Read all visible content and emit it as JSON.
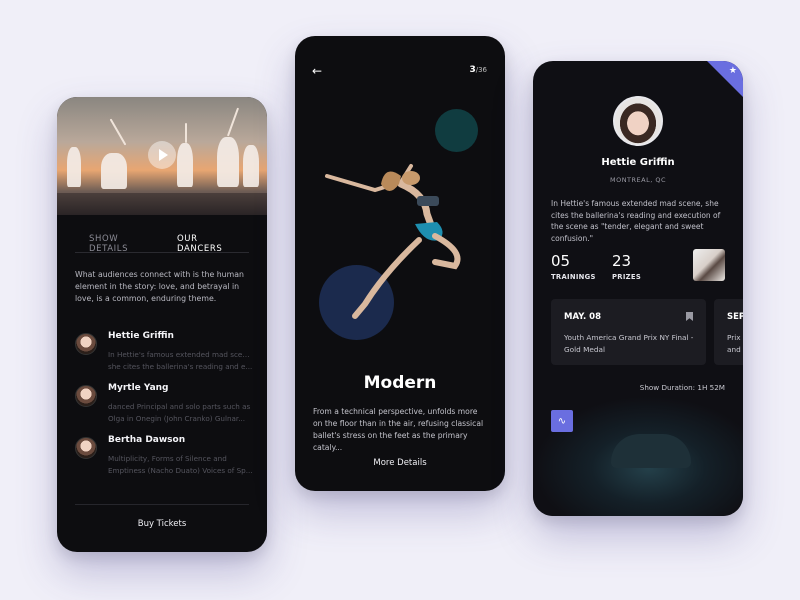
{
  "screen1": {
    "tabs": [
      "SHOW DETAILS",
      "OUR DANCERS"
    ],
    "intro": "What audiences connect with is the human element in the story: love, and betrayal in love, is a common, enduring theme.",
    "dancers": [
      {
        "name": "Hettie Griffin",
        "desc1": "In Hettie's famous extended mad scene,",
        "desc2": "she cites the ballerina's reading and e..."
      },
      {
        "name": "Myrtle Yang",
        "desc1": "danced Principal and solo parts such as",
        "desc2": "Olga in Onegin (John Cranko) Gulnar..."
      },
      {
        "name": "Bertha Dawson",
        "desc1": "Multiplicity, Forms of Silence and",
        "desc2": "Emptiness (Nacho Duato) Voices of Sp..."
      }
    ],
    "buy_label": "Buy Tickets"
  },
  "screen2": {
    "back": "←",
    "counter_current": "3",
    "counter_total": "/36",
    "title": "Modern",
    "desc": "From a technical perspective, unfolds more on the floor than in the air, refusing classical ballet's stress on the feet as the primary cataly...",
    "more_label": "More Details"
  },
  "screen3": {
    "corner_icon": "★",
    "name": "Hettie Griffin",
    "location": "MONTREAL, QC",
    "bio": "In Hettie's famous extended mad scene, she cites the ballerina's reading and execution of the scene as \"tender, elegant and sweet confusion.\"",
    "stats": [
      {
        "value": "05",
        "label": "TRAININGS"
      },
      {
        "value": "23",
        "label": "PRIZES"
      }
    ],
    "cards": [
      {
        "date": "MAY. 08",
        "event": "Youth America Grand Prix NY Final - Gold Medal"
      },
      {
        "date": "SEP",
        "event": "Prix and"
      }
    ],
    "duration": "Show Duration: 1H 52M",
    "wave_icon": "∿"
  },
  "colors": {
    "accent": "#6a6ee0",
    "background": "#f0eff8",
    "phone": "#0d0d10"
  }
}
